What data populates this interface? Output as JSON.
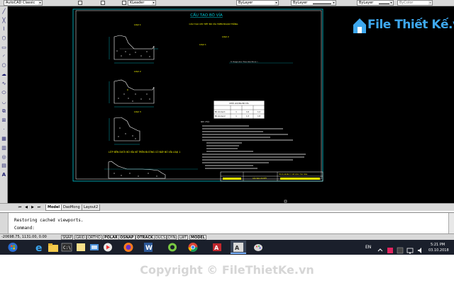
{
  "toolbar": {
    "style_name": "AutoCAD Classic",
    "leader_style": "KLeader",
    "layer_control": "ByLayer",
    "linetype_control": "ByLayer",
    "lineweight_control": "ByLayer",
    "color_control": "ByColor"
  },
  "drawing": {
    "title": "CẤU TẠO BÓ VỈA",
    "subtitle": "CẤU TẠO CHI TIẾT BÓ VỈA TRÊN ĐOẠN THẲNG",
    "loai1_label": "LOẠI 1",
    "loai2_label": "LOẠI 2",
    "loai3_label": "LOẠI 3",
    "loai2_right_label": "LOẠI 2",
    "loai1_right_label": "LOẠI 1",
    "bottom_title": "LỚP BÊN DƯỚI BÓ VỈA KÉ TRÊN ĐƯỜNG CÓ ĐÁY BÓ VỈA LOẠI 1",
    "table_title": "KHỐI LƯỢNG BÓ VỈA",
    "table_rows": [
      "Bó vỉa loại 1",
      "Bó vỉa loại 2"
    ],
    "table_values": [
      [
        "1",
        "1.6",
        "1.2"
      ],
      [
        "1",
        "1.3",
        "1.8"
      ]
    ],
    "notes_header": "Ghi chú:",
    "title_block_name": "CẤU TẠO CHI TIẾT",
    "title_block_project": "TÊN DỰ ÁN ĐẦU TƯ XÂY DỰNG CÔNG TRÌNH"
  },
  "tabs": {
    "items": [
      "Model",
      "DaoMong",
      "Layout2"
    ]
  },
  "command": {
    "history": "Restoring cached viewports.",
    "prompt": "Command:"
  },
  "status": {
    "coords": "-20698.75, 1131.00, 0.00",
    "buttons": [
      "SNAP",
      "GRID",
      "ORTHO",
      "POLAR",
      "OSNAP",
      "OTRACK",
      "DUCS",
      "DYN",
      "LWT",
      "MODEL"
    ]
  },
  "taskbar": {
    "lang": "EN",
    "time": "5:21 PM",
    "date": "03.10.2018"
  },
  "watermark": {
    "logo_text": "File Thiết Kế.vn",
    "copyright": "Copyright © FileThietKe.vn"
  },
  "colors": {
    "canvas_bg": "#000000",
    "cad_cyan": "#00c8d7",
    "cad_yellow": "#ffff00",
    "cad_white": "#ffffff",
    "logo_blue": "#3ea8ee"
  }
}
